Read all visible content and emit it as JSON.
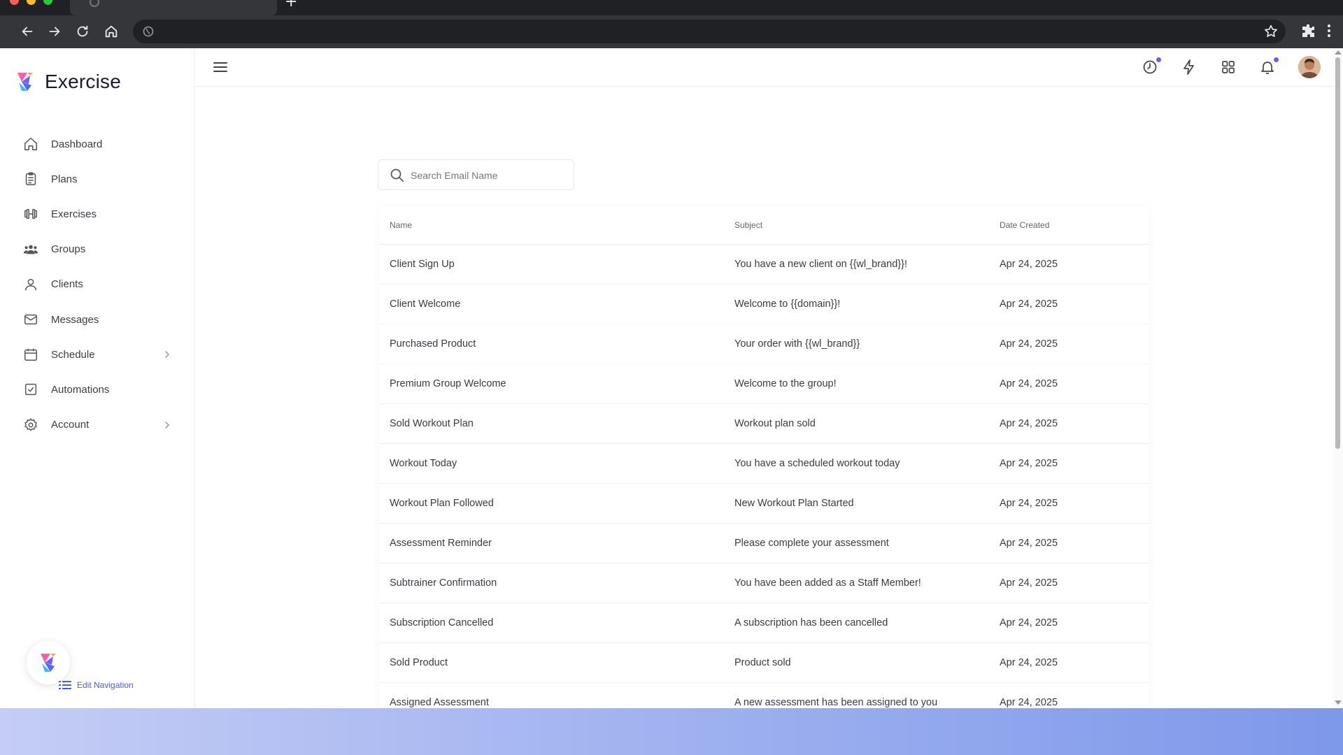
{
  "app": {
    "brand": "Exercise",
    "colors": {
      "accent": "#4f5bd5",
      "notification_dot": "#6d5df5"
    }
  },
  "browser": {
    "icons": [
      "back-icon",
      "forward-icon",
      "reload-icon",
      "home-icon",
      "globe-icon",
      "star-icon",
      "extensions-icon",
      "more-icon"
    ]
  },
  "sidebar": {
    "items": [
      {
        "label": "Dashboard",
        "icon": "home-icon",
        "has_children": false
      },
      {
        "label": "Plans",
        "icon": "clipboard-icon",
        "has_children": false
      },
      {
        "label": "Exercises",
        "icon": "dumbbell-icon",
        "has_children": false
      },
      {
        "label": "Groups",
        "icon": "users-icon",
        "has_children": false
      },
      {
        "label": "Clients",
        "icon": "user-icon",
        "has_children": false
      },
      {
        "label": "Messages",
        "icon": "mail-icon",
        "has_children": false
      },
      {
        "label": "Schedule",
        "icon": "calendar-icon",
        "has_children": true
      },
      {
        "label": "Automations",
        "icon": "checkbox-icon",
        "has_children": false
      },
      {
        "label": "Account",
        "icon": "gear-icon",
        "has_children": true
      }
    ],
    "edit_navigation": "Edit Navigation"
  },
  "topbar": {
    "icons": [
      "history-icon",
      "lightning-icon",
      "apps-grid-icon",
      "bell-icon",
      "avatar"
    ]
  },
  "search": {
    "placeholder": "Search Email Name",
    "value": ""
  },
  "table": {
    "headers": {
      "name": "Name",
      "subject": "Subject",
      "date": "Date Created"
    },
    "rows": [
      {
        "name": "Client Sign Up",
        "subject": "You have a new client on {{wl_brand}}!",
        "date": "Apr 24, 2025"
      },
      {
        "name": "Client Welcome",
        "subject": "Welcome to {{domain}}!",
        "date": "Apr 24, 2025"
      },
      {
        "name": "Purchased Product",
        "subject": "Your order with {{wl_brand}}",
        "date": "Apr 24, 2025"
      },
      {
        "name": "Premium Group Welcome",
        "subject": "Welcome to the group!",
        "date": "Apr 24, 2025"
      },
      {
        "name": "Sold Workout Plan",
        "subject": "Workout plan sold",
        "date": "Apr 24, 2025"
      },
      {
        "name": "Workout Today",
        "subject": "You have a scheduled workout today",
        "date": "Apr 24, 2025"
      },
      {
        "name": "Workout Plan Followed",
        "subject": "New Workout Plan Started",
        "date": "Apr 24, 2025"
      },
      {
        "name": "Assessment Reminder",
        "subject": "Please complete your assessment",
        "date": "Apr 24, 2025"
      },
      {
        "name": "Subtrainer Confirmation",
        "subject": "You have been added as a Staff Member!",
        "date": "Apr 24, 2025"
      },
      {
        "name": "Subscription Cancelled",
        "subject": "A subscription has been cancelled",
        "date": "Apr 24, 2025"
      },
      {
        "name": "Sold Product",
        "subject": "Product sold",
        "date": "Apr 24, 2025"
      },
      {
        "name": "Assigned Assessment",
        "subject": "A new assessment has been assigned to you",
        "date": "Apr 24, 2025"
      }
    ]
  }
}
